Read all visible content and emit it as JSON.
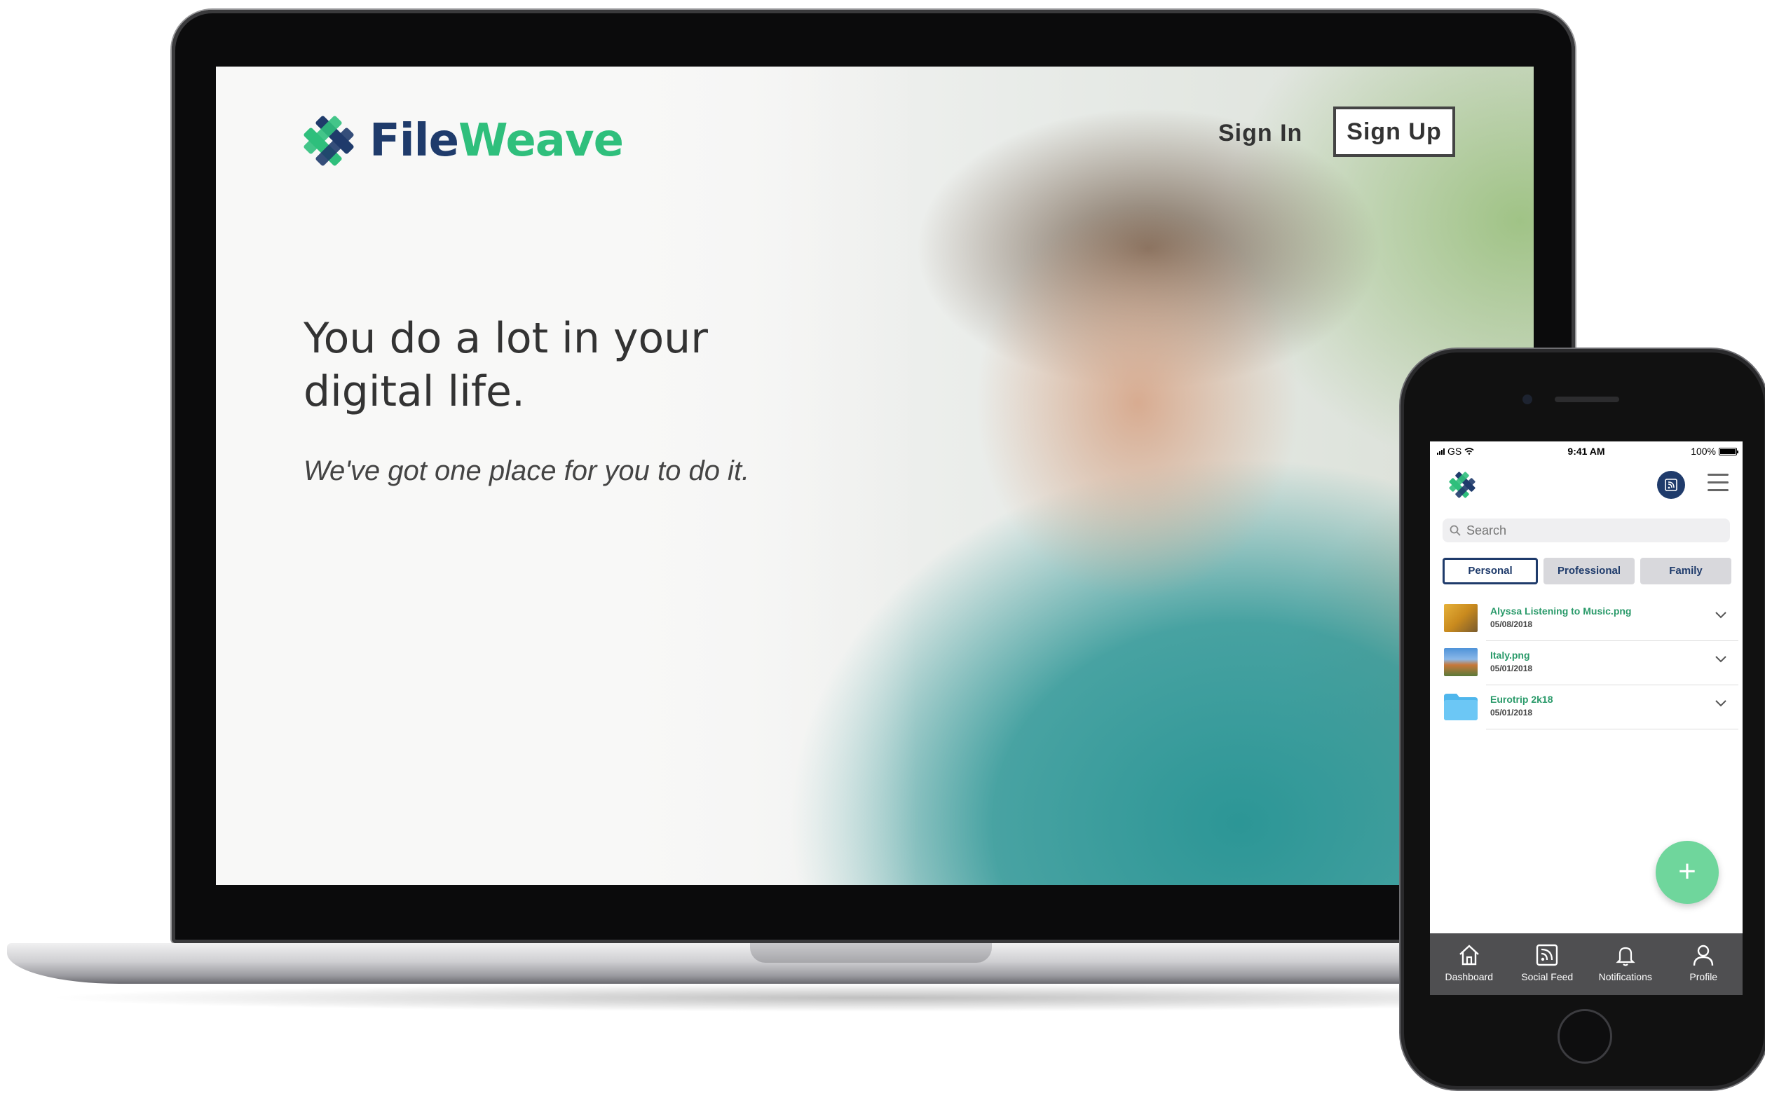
{
  "desktop": {
    "brand": {
      "name_part1": "File",
      "name_part2": "Weave"
    },
    "nav": {
      "sign_in": "Sign In",
      "sign_up": "Sign Up"
    },
    "hero": {
      "title": "You do a lot in your digital life.",
      "subtitle": "We've got one place for you to do it."
    }
  },
  "phone": {
    "status": {
      "carrier": "GS",
      "time": "9:41 AM",
      "battery": "100%"
    },
    "search": {
      "placeholder": "Search"
    },
    "segments": [
      "Personal",
      "Professional",
      "Family"
    ],
    "active_segment": "Personal",
    "files": [
      {
        "name": "Alyssa Listening to Music.png",
        "date": "05/08/2018",
        "icon": "image-thumbnail"
      },
      {
        "name": "Italy.png",
        "date": "05/01/2018",
        "icon": "image-thumbnail"
      },
      {
        "name": "Eurotrip 2k18",
        "date": "05/01/2018",
        "icon": "folder-icon"
      }
    ],
    "fab_label": "+",
    "tabs": [
      {
        "label": "Dashboard",
        "icon": "home-icon"
      },
      {
        "label": "Social Feed",
        "icon": "feed-icon"
      },
      {
        "label": "Notifications",
        "icon": "bell-icon"
      },
      {
        "label": "Profile",
        "icon": "profile-icon"
      }
    ]
  },
  "colors": {
    "brand_navy": "#1f3b6b",
    "brand_green": "#2fbf7c",
    "fab_green": "#6fd69c",
    "tabbar": "#4f4f51"
  }
}
